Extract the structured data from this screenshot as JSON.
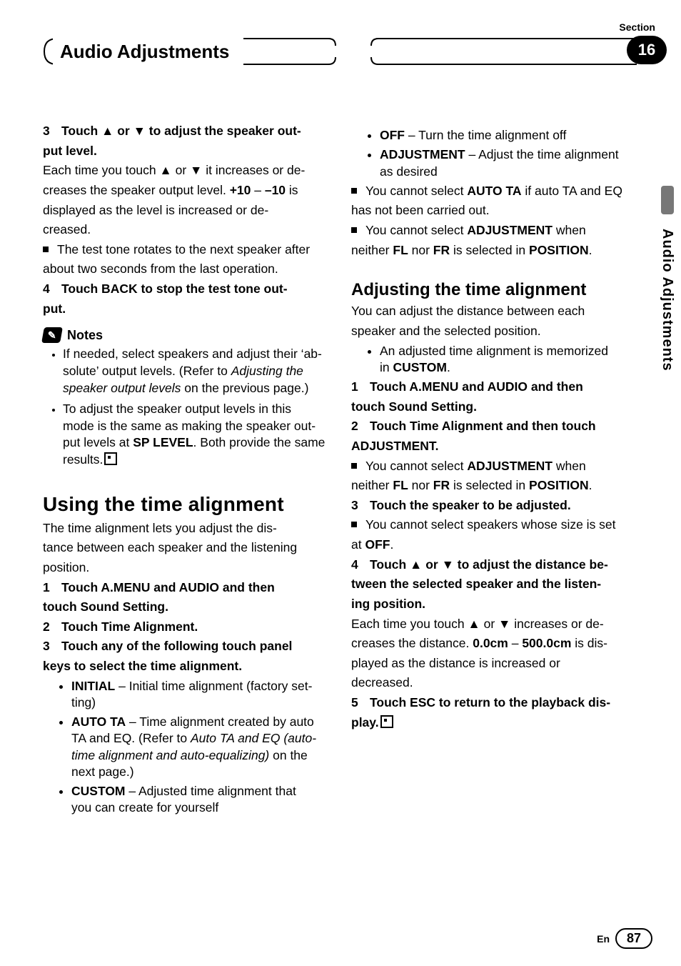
{
  "header": {
    "section_label": "Section",
    "chapter_number": "16",
    "title": "Audio Adjustments"
  },
  "side_tab": {
    "label": "Audio Adjustments"
  },
  "footer": {
    "lang": "En",
    "page": "87"
  },
  "left": {
    "s3_head_a": "3",
    "s3_head_b": "Touch ▲ or ▼ to adjust the speaker out-",
    "s3_head_c": "put level.",
    "s3_body_1": "Each time you touch ▲ or ▼ it increases or de-",
    "s3_body_2": "creases the speaker output level. ",
    "s3_body_2b": "+10",
    "s3_body_2c": " – ",
    "s3_body_2d": "–10",
    "s3_body_2e": " is",
    "s3_body_3": "displayed as the level is increased or de-",
    "s3_body_4": "creased.",
    "s3_sq_1": "The test tone rotates to the next speaker after",
    "s3_sq_2": "about two seconds from the last operation.",
    "s4_head_a": "4",
    "s4_head_b": "Touch BACK to stop the test tone out-",
    "s4_head_c": "put.",
    "notes_label": "Notes",
    "note1_a": "If needed, select speakers and adjust their ‘ab-",
    "note1_b": "solute’ output levels. (Refer to ",
    "note1_c": "Adjusting the",
    "note1_d": "speaker output levels",
    "note1_e": " on the previous page.)",
    "note2_a": "To adjust the speaker output levels in this",
    "note2_b": "mode is the same as making the speaker out-",
    "note2_c": "put levels at ",
    "note2_c2": "SP LEVEL",
    "note2_c3": ". Both provide the same",
    "note2_d": "results.",
    "h1": "Using the time alignment",
    "h1_body_1": "The time alignment lets you adjust the dis-",
    "h1_body_2": "tance between each speaker and the listening",
    "h1_body_3": "position.",
    "u1_a": "1",
    "u1_b": "Touch A.MENU and AUDIO and then",
    "u1_c": "touch Sound Setting.",
    "u2_a": "2",
    "u2_b": "Touch Time Alignment.",
    "u3_a": "3",
    "u3_b": "Touch any of the following touch panel",
    "u3_c": "keys to select the time alignment.",
    "opt_initial_k": "INITIAL",
    "opt_initial_t1": " – Initial time alignment (factory set-",
    "opt_initial_t2": "ting)",
    "opt_auto_k": "AUTO TA",
    "opt_auto_t1": " – Time alignment created by auto",
    "opt_auto_t2": "TA and EQ. (Refer to ",
    "opt_auto_t3": "Auto TA and EQ (auto-",
    "opt_auto_t4": "time alignment and auto-equalizing)",
    "opt_auto_t5": " on the",
    "opt_auto_t6": "next page.)",
    "opt_custom_k": "CUSTOM",
    "opt_custom_t1": " – Adjusted time alignment that",
    "opt_custom_t2": "you can create for yourself"
  },
  "right": {
    "opt_off_k": "OFF",
    "opt_off_t": " – Turn the time alignment off",
    "opt_adj_k": "ADJUSTMENT",
    "opt_adj_t1": " – Adjust the time alignment",
    "opt_adj_t2": "as desired",
    "sqA_1a": "You cannot select ",
    "sqA_1b": "AUTO TA",
    "sqA_1c": " if auto TA and EQ",
    "sqA_2": "has not been carried out.",
    "sqB_1a": "You cannot select ",
    "sqB_1b": "ADJUSTMENT",
    "sqB_1c": " when",
    "sqB_2a": "neither ",
    "sqB_2b": "FL",
    "sqB_2c": " nor ",
    "sqB_2d": "FR",
    "sqB_2e": " is selected in ",
    "sqB_2f": "POSITION",
    "sqB_2g": ".",
    "h2": "Adjusting the time alignment",
    "h2_body_1": "You can adjust the distance between each",
    "h2_body_2": "speaker and the selected position.",
    "h2_li_1": "An adjusted time alignment is memorized",
    "h2_li_2a": "in ",
    "h2_li_2b": "CUSTOM",
    "h2_li_2c": ".",
    "r1_a": "1",
    "r1_b": "Touch A.MENU and AUDIO and then",
    "r1_c": "touch Sound Setting.",
    "r2_a": "2",
    "r2_b": "Touch Time Alignment and then touch",
    "r2_c": "ADJUSTMENT.",
    "r2_sq_1a": "You cannot select ",
    "r2_sq_1b": "ADJUSTMENT",
    "r2_sq_1c": " when",
    "r2_sq_2a": "neither ",
    "r2_sq_2b": "FL",
    "r2_sq_2c": " nor ",
    "r2_sq_2d": "FR",
    "r2_sq_2e": " is selected in ",
    "r2_sq_2f": "POSITION",
    "r2_sq_2g": ".",
    "r3_a": "3",
    "r3_b": "Touch the speaker to be adjusted.",
    "r3_sq_1": "You cannot select speakers whose size is set",
    "r3_sq_2a": "at ",
    "r3_sq_2b": "OFF",
    "r3_sq_2c": ".",
    "r4_a": "4",
    "r4_b": "Touch ▲ or ▼ to adjust the distance be-",
    "r4_c": "tween the selected speaker and the listen-",
    "r4_d": "ing position.",
    "r4_body_1": "Each time you touch ▲ or ▼ increases or de-",
    "r4_body_2a": "creases the distance. ",
    "r4_body_2b": "0.0cm",
    "r4_body_2c": " – ",
    "r4_body_2d": "500.0cm",
    "r4_body_2e": " is dis-",
    "r4_body_3": "played as the distance is increased or",
    "r4_body_4": "decreased.",
    "r5_a": "5",
    "r5_b": "Touch ESC to return to the playback dis-",
    "r5_c": "play."
  }
}
